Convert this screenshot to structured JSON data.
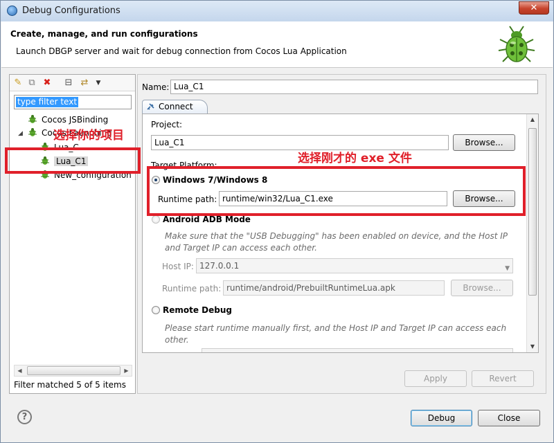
{
  "window": {
    "title": "Debug Configurations",
    "close_glyph": "✕"
  },
  "header": {
    "title": "Create, manage, and run configurations",
    "message": "Launch DBGP server and wait for debug connection from Cocos Lua Application"
  },
  "sidebar": {
    "toolbar_icons": [
      "new-config-icon",
      "duplicate-icon",
      "delete-icon",
      "collapse-all-icon",
      "filter-icon",
      "view-menu-icon"
    ],
    "filter_placeholder": "type filter text",
    "tree": [
      {
        "label": "Cocos JSBinding",
        "level": 0,
        "expanded": false
      },
      {
        "label": "Cocos Launching",
        "level": 0,
        "expanded": true
      },
      {
        "label": "Lua_C",
        "level": 1
      },
      {
        "label": "Lua_C1",
        "level": 1,
        "selected": true
      },
      {
        "label": "New_configuration",
        "level": 1
      }
    ],
    "status": "Filter matched 5 of 5 items"
  },
  "main": {
    "name_label": "Name:",
    "name_value": "Lua_C1",
    "tab_label": "Connect",
    "project_label": "Project:",
    "project_value": "Lua_C1",
    "browse_label": "Browse...",
    "target_platform_label": "Target Platform:",
    "windows_option": "Windows 7/Windows 8",
    "runtime_path_label": "Runtime path:",
    "runtime_path_value": "runtime/win32/Lua_C1.exe",
    "android_option": "Android ADB Mode",
    "android_hint": "Make sure that the \"USB Debugging\" has been enabled on device, and the Host IP and Target IP can access each other.",
    "host_ip_label": "Host IP:",
    "host_ip_value": "127.0.0.1",
    "android_runtime_label": "Runtime path:",
    "android_runtime_value": "runtime/android/PrebuiltRuntimeLua.apk",
    "remote_option": "Remote Debug",
    "remote_hint": "Please start runtime manually first, and the Host IP and Target IP can access each other.",
    "apply_label": "Apply",
    "revert_label": "Revert"
  },
  "footer": {
    "help_glyph": "?",
    "debug_label": "Debug",
    "close_label": "Close"
  },
  "annotations": {
    "select_project": "选择你的项目",
    "select_exe": "选择刚才的 exe 文件"
  },
  "colors": {
    "annotation": "#e0202a",
    "selection": "#3399ff",
    "bug_green": "#5fae2f"
  }
}
